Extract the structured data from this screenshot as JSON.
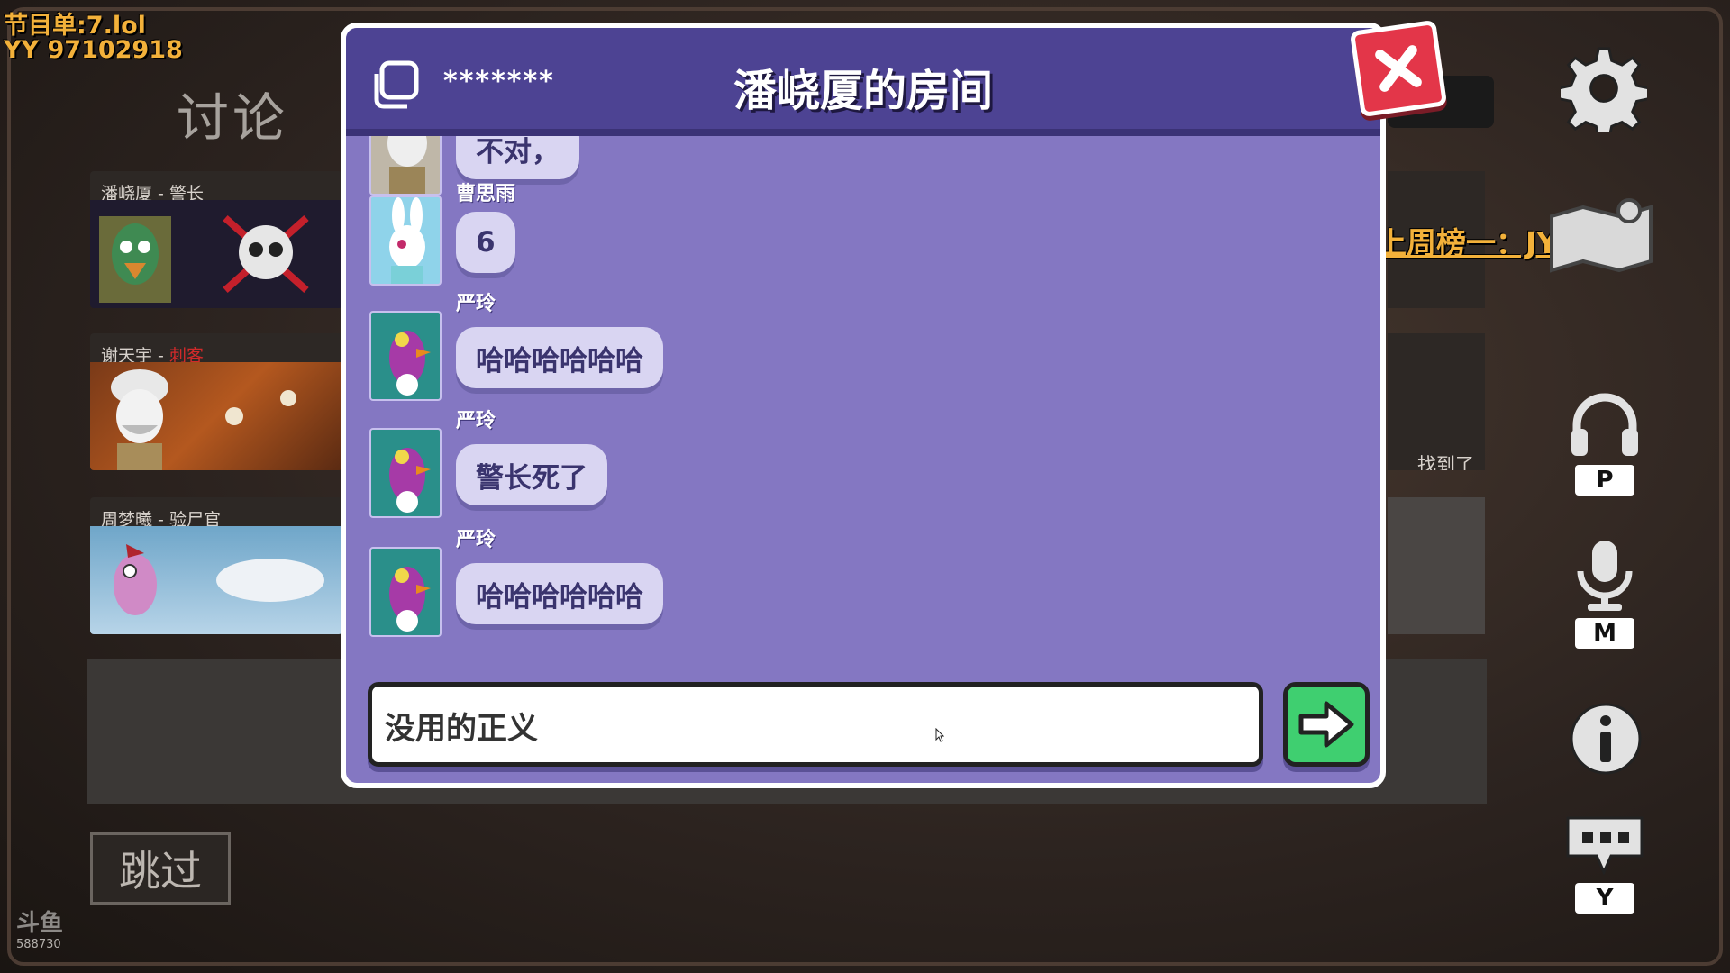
{
  "overlay": {
    "program_list": "节目单:7.lol",
    "yy_id": "YY 97102918",
    "thanks": "感谢上周榜一：JYA"
  },
  "stage": {
    "title": "讨论",
    "skip_label": "跳过"
  },
  "players": [
    {
      "name": "潘峣厦",
      "sep": " - ",
      "role": "警长",
      "role_color": "#d8d2cc",
      "dead": true
    },
    {
      "name": "谢天宇",
      "sep": " - ",
      "role": "刺客",
      "role_color": "#d12a2a",
      "dead": false
    },
    {
      "name": "周梦曦",
      "sep": " - ",
      "role": "验尸官",
      "role_color": "#d8d2cc",
      "dead": false
    }
  ],
  "right_card": {
    "found_label": "找到了"
  },
  "modal": {
    "password": "*******",
    "title": "潘峣厦的房间",
    "messages": [
      {
        "sender": "",
        "text": "不对，"
      },
      {
        "sender": "曹思雨",
        "text": "6"
      },
      {
        "sender": "严玲",
        "text": "哈哈哈哈哈哈"
      },
      {
        "sender": "严玲",
        "text": "警长死了"
      },
      {
        "sender": "严玲",
        "text": "哈哈哈哈哈哈"
      }
    ],
    "input_value": "没用的正义",
    "input_placeholder": ""
  },
  "sidebar": {
    "push_to_talk_key": "P",
    "mic_key": "M",
    "chat_key": "Y"
  },
  "watermark": {
    "text": "斗鱼",
    "sub": "588730"
  },
  "colors": {
    "accent_header": "#4d4393",
    "modal_bg": "#8477c2",
    "close_red": "#e33649",
    "send_green": "#3fcf70",
    "overlay_gold": "#f3b13a"
  }
}
